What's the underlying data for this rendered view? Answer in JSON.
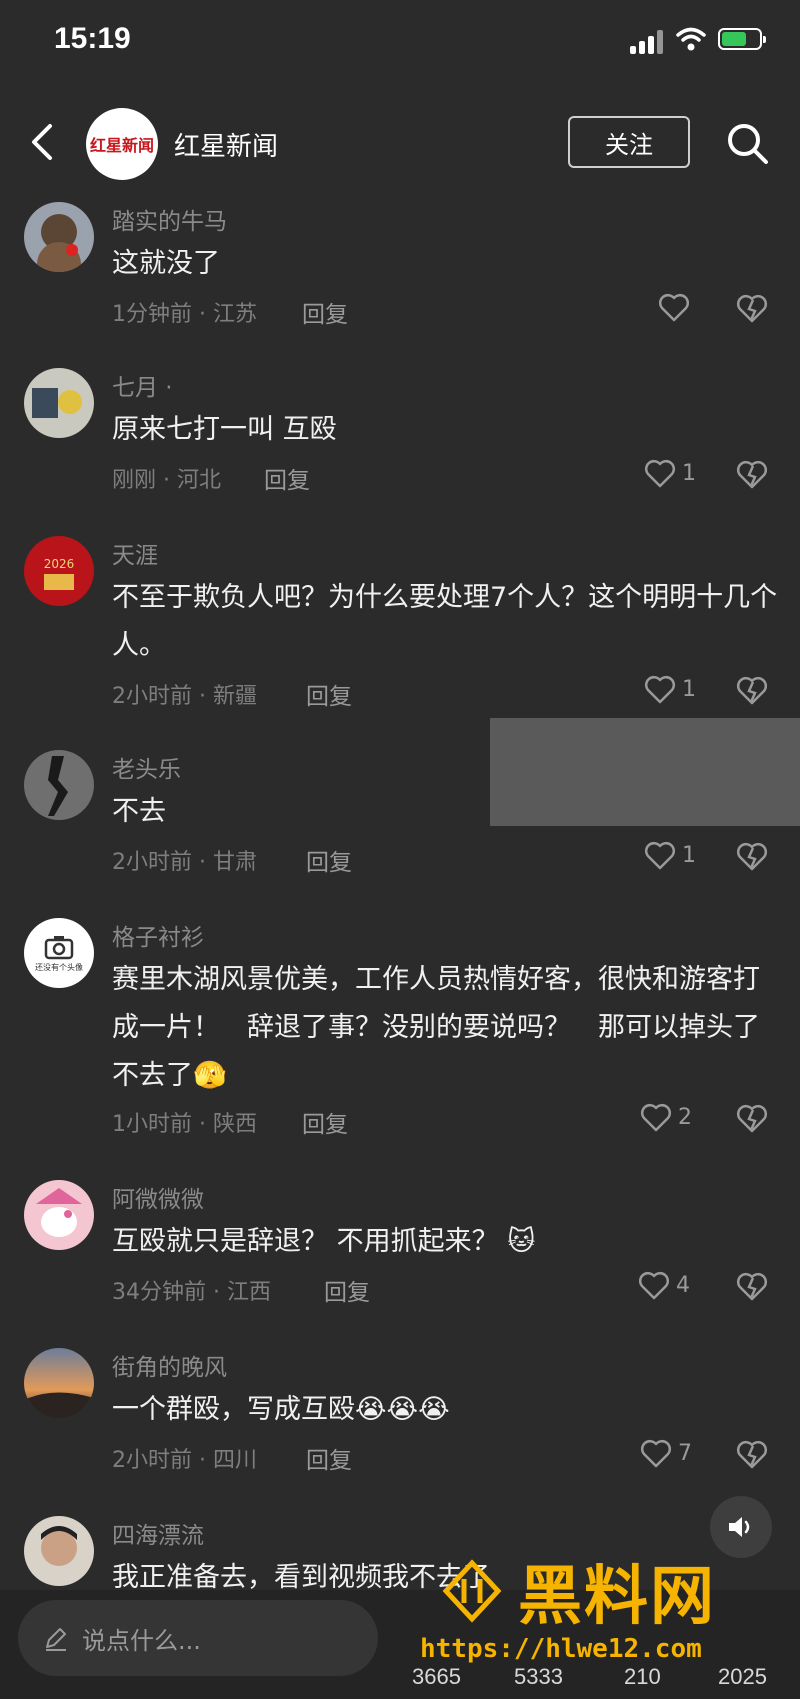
{
  "status": {
    "time": "15:19"
  },
  "header": {
    "channel_name": "红星新闻",
    "logo_text": "红星新闻",
    "follow_label": "关注"
  },
  "comments": [
    {
      "user": "踏实的牛马",
      "text": "这就没了",
      "time_loc": "1分钟前 · 江苏",
      "reply": "回复",
      "likes": ""
    },
    {
      "user": "七月 ·",
      "text": "原来七打一叫 互殴",
      "time_loc": "刚刚 · 河北",
      "reply": "回复",
      "likes": "1"
    },
    {
      "user": "天涯",
      "text": "不至于欺负人吧？为什么要处理7个人？这个明明十几个人。",
      "time_loc": "2小时前 · 新疆",
      "reply": "回复",
      "likes": "1"
    },
    {
      "user": "老头乐",
      "text": "不去",
      "time_loc": "2小时前 · 甘肃",
      "reply": "回复",
      "likes": "1"
    },
    {
      "user": "格子衬衫",
      "text": "赛里木湖风景优美，工作人员热情好客，很快和游客打成一片！　辞退了事？没别的要说吗？　那可以掉头了不去了",
      "emoji": "🫣",
      "time_loc": "1小时前 · 陕西",
      "reply": "回复",
      "likes": "2",
      "avatar_text": "还没有个头像"
    },
    {
      "user": "阿微微微",
      "text": "互殴就只是辞退？ 不用抓起来？",
      "emoji": "🐱",
      "time_loc": "34分钟前 · 江西",
      "reply": "回复",
      "likes": "4"
    },
    {
      "user": "街角的晚风",
      "text": "一个群殴，写成互殴",
      "emoji": "😭😭😭",
      "time_loc": "2小时前 · 四川",
      "reply": "回复",
      "likes": "7"
    },
    {
      "user": "四海漂流",
      "text": "我正准备去，看到视频我不去了",
      "time_loc": "",
      "reply": "",
      "likes": ""
    }
  ],
  "bottom": {
    "input_placeholder": "说点什么...",
    "stats": [
      "3665",
      "5333",
      "210",
      "2025"
    ]
  },
  "watermark": {
    "brand": "黑料网",
    "url": "https://hlwe12.com"
  },
  "colors": {
    "background": "#2b2b2b",
    "accent_watermark": "#f6b400",
    "logo_red": "#c8161d"
  }
}
